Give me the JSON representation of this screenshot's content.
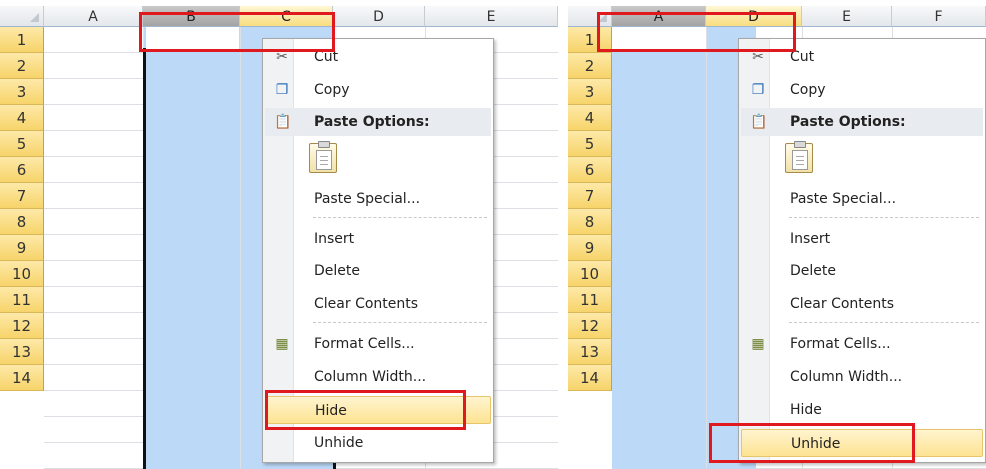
{
  "left": {
    "columns": [
      "A",
      "B",
      "C",
      "D",
      "E"
    ],
    "rows": [
      "1",
      "2",
      "3",
      "4",
      "5",
      "6",
      "7",
      "8",
      "9",
      "10",
      "11",
      "12",
      "13",
      "14"
    ],
    "menu": {
      "cut_label": "Cut",
      "copy_label": "Copy",
      "paste_options_label": "Paste Options:",
      "paste_special_label": "Paste Special...",
      "insert_label": "Insert",
      "delete_label": "Delete",
      "clear_contents_label": "Clear Contents",
      "format_cells_label": "Format Cells...",
      "column_width_label": "Column Width...",
      "hide_label": "Hide",
      "unhide_label": "Unhide",
      "highlighted_item": "Hide"
    }
  },
  "right": {
    "columns": [
      "A",
      "D",
      "E",
      "F"
    ],
    "rows": [
      "1",
      "2",
      "3",
      "4",
      "5",
      "6",
      "7",
      "8",
      "9",
      "10",
      "11",
      "12",
      "13",
      "14"
    ],
    "menu": {
      "cut_label": "Cut",
      "copy_label": "Copy",
      "paste_options_label": "Paste Options:",
      "paste_special_label": "Paste Special...",
      "insert_label": "Insert",
      "delete_label": "Delete",
      "clear_contents_label": "Clear Contents",
      "format_cells_label": "Format Cells...",
      "column_width_label": "Column Width...",
      "hide_label": "Hide",
      "unhide_label": "Unhide",
      "highlighted_item": "Unhide"
    }
  },
  "colors": {
    "selection": "#bcd9f7",
    "row_header": "#f7d46a",
    "highlight_box": "#e0191f",
    "menu_highlight": "#fde392"
  },
  "icons": {
    "cut": "scissors-icon",
    "copy": "copy-icon",
    "paste": "clipboard-icon",
    "format_cells": "format-cells-icon"
  }
}
